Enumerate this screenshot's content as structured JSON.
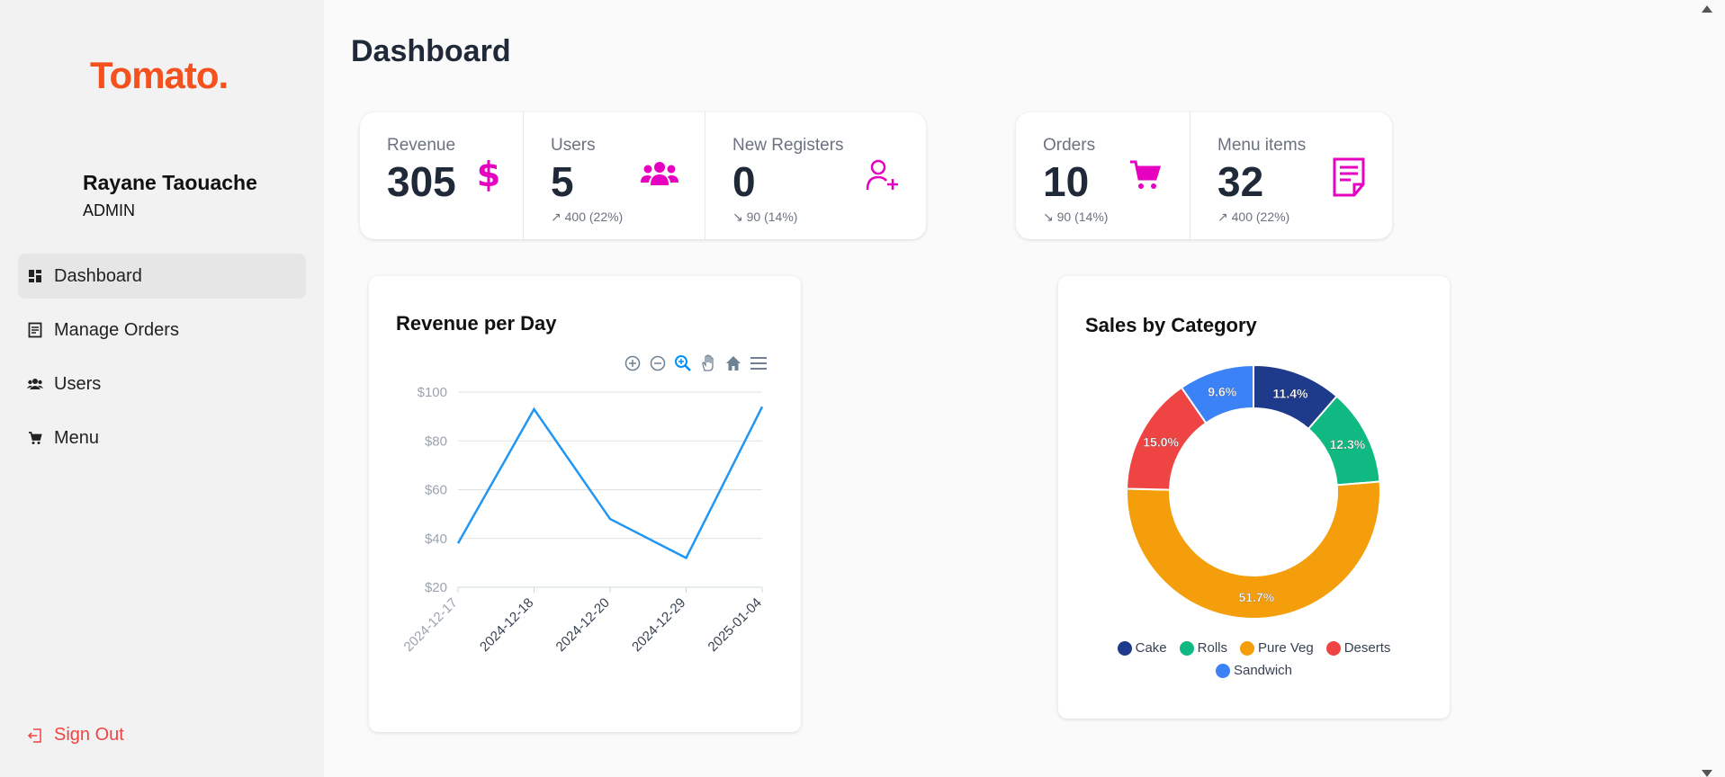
{
  "sidebar": {
    "logo": "Tomato.",
    "user_name": "Rayane Taouache",
    "user_role": "ADMIN",
    "nav": [
      {
        "label": "Dashboard",
        "icon": "dashboard-icon",
        "active": true
      },
      {
        "label": "Manage Orders",
        "icon": "orders-icon",
        "active": false
      },
      {
        "label": "Users",
        "icon": "users-icon",
        "active": false
      },
      {
        "label": "Menu",
        "icon": "cart-icon",
        "active": false
      }
    ],
    "sign_out": "Sign Out"
  },
  "page_title": "Dashboard",
  "stats": {
    "revenue": {
      "label": "Revenue",
      "value": "305",
      "icon": "dollar-icon"
    },
    "users": {
      "label": "Users",
      "value": "5",
      "trend": "↗ 400 (22%)",
      "icon": "users-icon"
    },
    "new_registers": {
      "label": "New Registers",
      "value": "0",
      "trend": "↘ 90 (14%)",
      "icon": "user-plus-icon"
    },
    "orders": {
      "label": "Orders",
      "value": "10",
      "trend": "↘ 90 (14%)",
      "icon": "cart-icon"
    },
    "menu_items": {
      "label": "Menu items",
      "value": "32",
      "trend": "↗ 400 (22%)",
      "icon": "menu-doc-icon"
    }
  },
  "colors": {
    "accent": "#e600c0",
    "brand": "#f4511e",
    "line": "#2196f3"
  },
  "chart_data": [
    {
      "type": "line",
      "title": "Revenue per Day",
      "x": [
        "2024-12-17",
        "2024-12-18",
        "2024-12-20",
        "2024-12-29",
        "2025-01-04"
      ],
      "series": [
        {
          "values": [
            38,
            93,
            48,
            32,
            94
          ]
        }
      ],
      "y_ticks": [
        "$100",
        "$80",
        "$60",
        "$40",
        "$20"
      ],
      "ylim": [
        20,
        100
      ],
      "grid": true
    },
    {
      "type": "pie",
      "title": "Sales by Category",
      "categories": [
        "Cake",
        "Rolls",
        "Pure Veg",
        "Deserts",
        "Sandwich"
      ],
      "values": [
        11.4,
        12.3,
        51.7,
        15.0,
        9.6
      ],
      "labels": [
        "11.4%",
        "12.3%",
        "51.7%",
        "15.0%",
        "9.6%"
      ],
      "colors": [
        "#1e3a8a",
        "#10b981",
        "#f59e0b",
        "#ef4444",
        "#3b82f6"
      ],
      "legend": "bottom"
    }
  ]
}
